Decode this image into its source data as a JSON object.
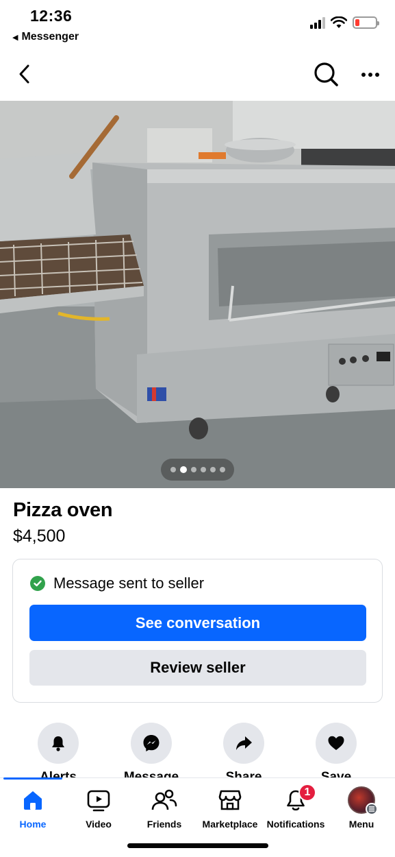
{
  "status_bar": {
    "time": "12:36",
    "back_app": "Messenger",
    "back_icon": "back-triangle-icon",
    "battery_color": "#ff3b30"
  },
  "navbar": {
    "back_icon": "chevron-left-icon",
    "search_icon": "search-icon",
    "more_icon": "more-horizontal-icon"
  },
  "photo": {
    "description_icon": "listing-photo",
    "carousel": {
      "count": 6,
      "active_index": 1
    }
  },
  "listing": {
    "title": "Pizza oven",
    "price": "$4,500"
  },
  "message_card": {
    "status_text": "Message sent to seller",
    "status_icon": "check-circle-icon",
    "primary_button": "See conversation",
    "secondary_button": "Review seller",
    "primary_color": "#0866ff",
    "success_color": "#31a24c"
  },
  "actions": [
    {
      "label": "Alerts",
      "icon": "bell-icon"
    },
    {
      "label": "Message",
      "icon": "messenger-icon"
    },
    {
      "label": "Share",
      "icon": "share-arrow-icon"
    },
    {
      "label": "Save",
      "icon": "heart-icon"
    }
  ],
  "tabbar": {
    "tabs": [
      {
        "label": "Home",
        "icon": "home-icon",
        "active": true
      },
      {
        "label": "Video",
        "icon": "video-icon",
        "active": false
      },
      {
        "label": "Friends",
        "icon": "friends-icon",
        "active": false
      },
      {
        "label": "Marketplace",
        "icon": "marketplace-icon",
        "active": false
      },
      {
        "label": "Notifications",
        "icon": "bell-outline-icon",
        "active": false,
        "badge": "1"
      },
      {
        "label": "Menu",
        "icon": "avatar-icon",
        "active": false
      }
    ],
    "active_color": "#0866ff",
    "badge_color": "#e41e3f"
  }
}
